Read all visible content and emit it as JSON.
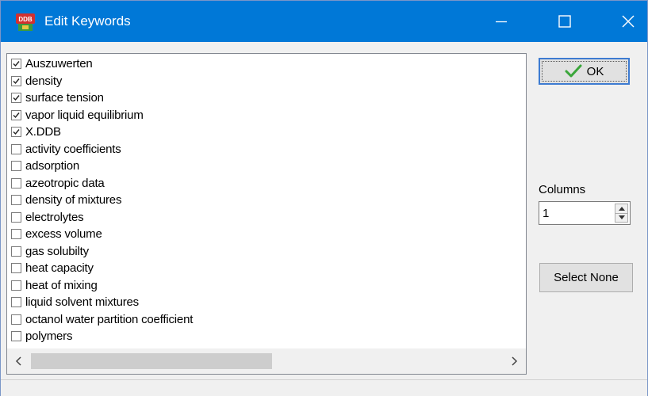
{
  "window": {
    "title": "Edit Keywords",
    "app_icon": "ddb-app-icon",
    "controls": [
      "minimize-icon",
      "maximize-icon",
      "close-icon"
    ],
    "accent_color": "#0078d7"
  },
  "keywords": [
    {
      "label": "Auszuwerten",
      "checked": true
    },
    {
      "label": "density",
      "checked": true
    },
    {
      "label": "surface tension",
      "checked": true
    },
    {
      "label": "vapor liquid equilibrium",
      "checked": true
    },
    {
      "label": "X.DDB",
      "checked": true
    },
    {
      "label": "activity coefficients",
      "checked": false
    },
    {
      "label": "adsorption",
      "checked": false
    },
    {
      "label": "azeotropic data",
      "checked": false
    },
    {
      "label": "density of mixtures",
      "checked": false
    },
    {
      "label": "electrolytes",
      "checked": false
    },
    {
      "label": "excess volume",
      "checked": false
    },
    {
      "label": "gas solubilty",
      "checked": false
    },
    {
      "label": "heat capacity",
      "checked": false
    },
    {
      "label": "heat of mixing",
      "checked": false
    },
    {
      "label": "liquid solvent mixtures",
      "checked": false
    },
    {
      "label": "octanol water partition coefficient",
      "checked": false
    },
    {
      "label": "polymers",
      "checked": false
    }
  ],
  "buttons": {
    "ok_label": "OK",
    "select_none_label": "Select None"
  },
  "columns": {
    "label": "Columns",
    "value": "1"
  }
}
